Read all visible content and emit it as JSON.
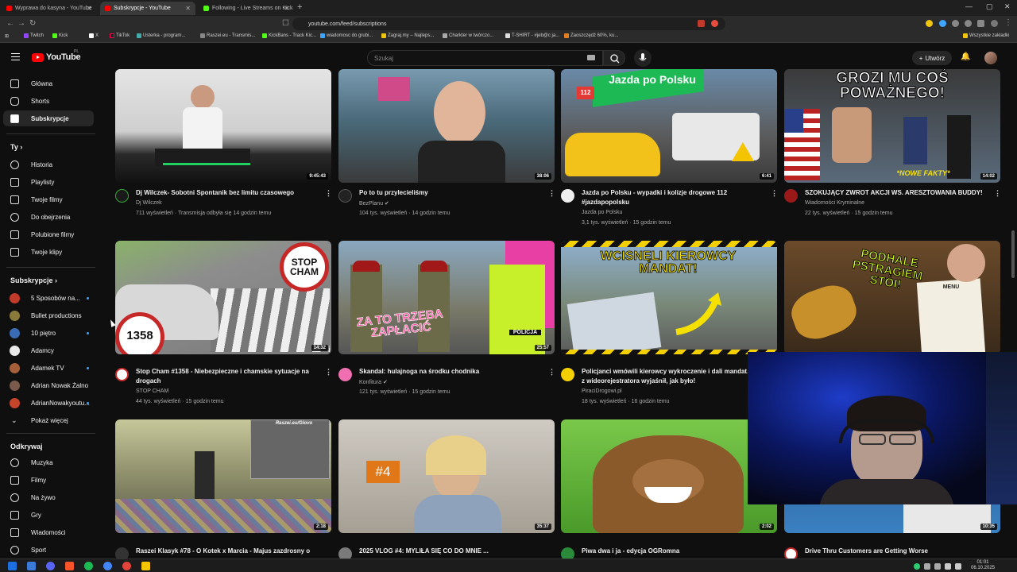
{
  "browser": {
    "tabs": [
      {
        "title": "Wyprawa do kasyna - YouTube",
        "color": "#ff0000"
      },
      {
        "title": "Subskrypcje - YouTube",
        "color": "#ff0000"
      },
      {
        "title": "Following - Live Streams on Kick",
        "color": "#53fc18"
      }
    ],
    "url": "youtube.com/feed/subscriptions",
    "bookmarks": [
      "Twitch",
      "Kick",
      "X",
      "TikTok",
      "Usterka - program...",
      "Raszei.eu - Transmis...",
      "KickBans - Track Kic...",
      "wiadomosc do grubi...",
      "Zagraj.my – Najleps...",
      "Charkter w twórczo...",
      "T-SHIRT - #jeb@c ja...",
      "Zaoszczędź 60%, ku..."
    ],
    "bookmarks_folder": "Wszystkie zakładki"
  },
  "masthead": {
    "logo": "YouTube",
    "country": "PL",
    "search_placeholder": "Szukaj",
    "create_label": "Utwórz"
  },
  "sidebar": {
    "main": [
      {
        "label": "Główna",
        "icon": "home-icon"
      },
      {
        "label": "Shorts",
        "icon": "shorts-icon"
      },
      {
        "label": "Subskrypcje",
        "icon": "subscriptions-icon"
      }
    ],
    "you_header": "Ty",
    "you": [
      {
        "label": "Historia",
        "icon": "history-icon"
      },
      {
        "label": "Playlisty",
        "icon": "playlists-icon"
      },
      {
        "label": "Twoje filmy",
        "icon": "your-videos-icon"
      },
      {
        "label": "Do obejrzenia",
        "icon": "watch-later-icon"
      },
      {
        "label": "Polubione filmy",
        "icon": "liked-icon"
      },
      {
        "label": "Twoje klipy",
        "icon": "clips-icon"
      }
    ],
    "subs_header": "Subskrypcje",
    "subs": [
      {
        "label": "5 Sposobów na...",
        "dot": true,
        "color": "#c23a2a"
      },
      {
        "label": "Bullet productions",
        "dot": false,
        "color": "#8b7b3a"
      },
      {
        "label": "10 piętro",
        "dot": true,
        "color": "#3a6bb5"
      },
      {
        "label": "Adamcy",
        "dot": false,
        "color": "#e8e8e8"
      },
      {
        "label": "Adamek TV",
        "dot": true,
        "color": "#a5603a"
      },
      {
        "label": "Adrian Nowak Żalno",
        "dot": false,
        "color": "#7a5a4a"
      },
      {
        "label": "AdrianNowakyoutu...",
        "dot": true,
        "color": "#c4452a"
      }
    ],
    "show_more": "Pokaż więcej",
    "explore_header": "Odkrywaj",
    "explore": [
      {
        "label": "Muzyka",
        "icon": "music-icon"
      },
      {
        "label": "Filmy",
        "icon": "movies-icon"
      },
      {
        "label": "Na żywo",
        "icon": "live-icon"
      },
      {
        "label": "Gry",
        "icon": "gaming-icon"
      },
      {
        "label": "Wiadomości",
        "icon": "news-icon"
      },
      {
        "label": "Sport",
        "icon": "sport-icon"
      }
    ]
  },
  "videos": [
    {
      "title": "Dj Wilczek- Sobotni Spontanik bez limitu czasowego",
      "channel": "Dj Wilczek",
      "meta": "711 wyświetleń · Transmisja odbyła się 14 godzin temu",
      "duration": "9:45:43",
      "overlay": "",
      "verified": false
    },
    {
      "title": "Po to tu przylecieliśmy",
      "channel": "BezPlanu",
      "meta": "104 tys. wyświetleń · 14 godzin temu",
      "duration": "38:06",
      "overlay": "",
      "verified": true
    },
    {
      "title": "Jazda po Polsku - wypadki i kolizje drogowe 112 #jazdapopolsku",
      "channel": "Jazda po Polsku",
      "meta": "3,1 tys. wyświetleń · 15 godzin temu",
      "duration": "6:41",
      "overlay": "Jazda po Polsku",
      "badge": "112",
      "verified": false
    },
    {
      "title": "SZOKUJĄCY ZWROT AKCJI WS. ARESZTOWANIA BUDDY!",
      "channel": "Wiadomości Kryminalne",
      "meta": "22 tys. wyświetleń · 15 godzin temu",
      "duration": "14:02",
      "overlay": "GROZI MU COŚ POWAŻNEGO!",
      "sub_overlay": "*NOWE FAKTY*",
      "verified": false
    },
    {
      "title": "Stop Cham #1358 - Niebezpieczne i chamskie sytuacje na drogach",
      "channel": "STOP CHAM",
      "meta": "44 tys. wyświetleń · 15 godzin temu",
      "duration": "14:32",
      "overlay": "STOP CHAM",
      "badge": "1358",
      "verified": false
    },
    {
      "title": "Skandal: hulajnoga na środku chodnika",
      "channel": "Konfitura",
      "meta": "121 tys. wyświetleń · 15 godzin temu",
      "duration": "25:57",
      "overlay": "ZA TO TRZEBA ZAPŁACIĆ",
      "badge": "POLICJA",
      "verified": true
    },
    {
      "title": "Policjanci wmówili kierowcy wykroczenie i dali mandat. Film z wideorejestratora wyjaśnił, jak było!",
      "channel": "PiraciDrogowi.pl",
      "meta": "18 tys. wyświetleń · 16 godzin temu",
      "duration": "",
      "overlay": "WCISNĘLI KIEROWCY MANDAT!",
      "verified": false
    },
    {
      "title": "",
      "channel": "",
      "meta": "",
      "duration": "",
      "overlay": "PODHALE PSTRĄGIEM STOI!",
      "badge": "MENU",
      "verified": false
    },
    {
      "title": "Raszei Klasyk #78 - O Kotek x Marcia - Majus zazdrosny o",
      "channel": "",
      "meta": "",
      "duration": "2:18",
      "overlay": "Raszei.eu/Glovo",
      "verified": false
    },
    {
      "title": "2025 VLOG #4: MYLIŁA SIĘ CO DO MNIE ...",
      "channel": "",
      "meta": "",
      "duration": "35:37",
      "overlay": "#4",
      "verified": false
    },
    {
      "title": "Piwa dwa i ja - edycja OGRomna",
      "channel": "",
      "meta": "",
      "duration": "2:02",
      "overlay": "",
      "verified": false
    },
    {
      "title": "Drive Thru Customers are Getting Worse",
      "channel": "",
      "meta": "",
      "duration": "10:35",
      "overlay": "",
      "verified": false
    }
  ],
  "taskbar": {
    "time": "01:01",
    "date": "06.10.2025"
  }
}
